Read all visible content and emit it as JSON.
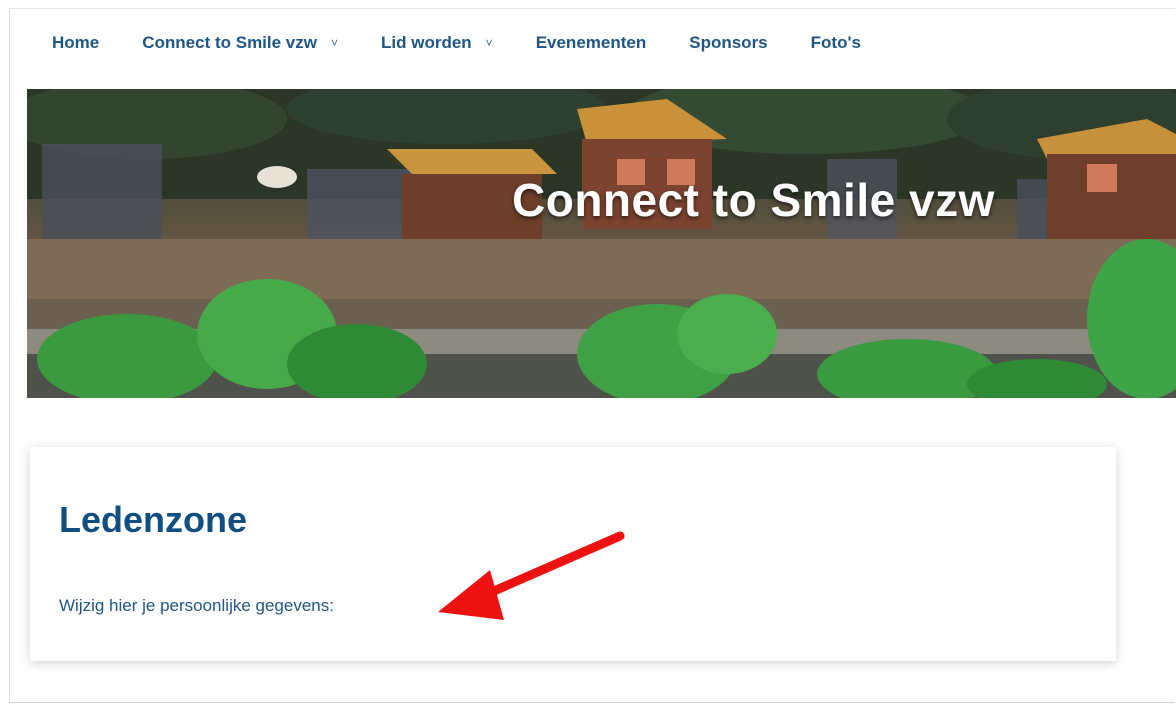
{
  "nav": {
    "items": [
      {
        "label": "Home",
        "has_dropdown": false
      },
      {
        "label": "Connect to Smile vzw",
        "has_dropdown": true
      },
      {
        "label": "Lid worden",
        "has_dropdown": true
      },
      {
        "label": "Evenementen",
        "has_dropdown": false
      },
      {
        "label": "Sponsors",
        "has_dropdown": false
      },
      {
        "label": "Foto's",
        "has_dropdown": false
      }
    ],
    "dropdown_glyph": "˅"
  },
  "hero": {
    "title": "Connect to Smile vzw"
  },
  "card": {
    "title": "Ledenzone",
    "text": "Wijzig hier je persoonlijke gegevens:"
  },
  "colors": {
    "nav_text": "#1f5685",
    "card_title": "#114e82",
    "annotation_arrow": "#ee1111"
  },
  "icons": {
    "annotation": "red-arrow-icon",
    "dropdown": "chevron-down-icon"
  }
}
